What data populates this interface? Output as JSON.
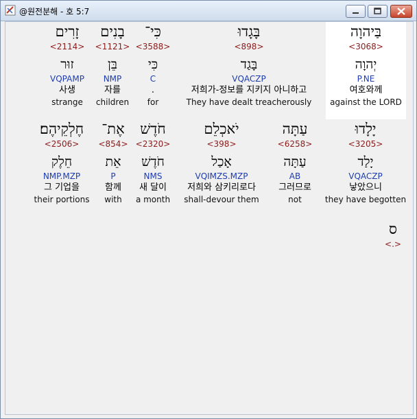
{
  "window": {
    "title": "@원전분해 - 호 5:7"
  },
  "rows": [
    [
      {
        "heb": "בַּיהוָה",
        "strong": "<3068>",
        "lex": "יְהוָה",
        "parse": "P.NE",
        "kor": "여호와께",
        "eng": "against the LORD"
      },
      {
        "heb": "בָּגָדוּ",
        "strong": "<898>",
        "lex": "בָּגַד",
        "parse": "VQACZP",
        "kor": "저희가-정보를 지키지 아니하고",
        "eng": "They have dealt treacherously"
      },
      {
        "heb": "כִּי־",
        "strong": "<3588>",
        "lex": "כִּי",
        "parse": "C",
        "kor": ".",
        "eng": "for"
      },
      {
        "heb": "בָנִים",
        "strong": "<1121>",
        "lex": "בֵּן",
        "parse": "NMP",
        "kor": "자를",
        "eng": "children"
      },
      {
        "heb": "זָרִים",
        "strong": "<2114>",
        "lex": "זוּר",
        "parse": "VQPAMP",
        "kor": "사생",
        "eng": "strange"
      }
    ],
    [
      {
        "heb": "יָלָדוּ",
        "strong": "<3205>",
        "lex": "יָלַד",
        "parse": "VQACZP",
        "kor": "낳았으니",
        "eng": "they have begotten"
      },
      {
        "heb": "עַתָּה",
        "strong": "<6258>",
        "lex": "עַתָּה",
        "parse": "AB",
        "kor": "그러므로",
        "eng": "not"
      },
      {
        "heb": "יֹאכְלֵם",
        "strong": "<398>",
        "lex": "אָכַל",
        "parse": "VQIMZS.MZP",
        "kor": "저희와 삼키리로다",
        "eng": "shall-devour them"
      },
      {
        "heb": "חֹדֶשׁ",
        "strong": "<2320>",
        "lex": "חֹדֶשׁ",
        "parse": "NMS",
        "kor": "새 달이",
        "eng": "a month"
      },
      {
        "heb": "אֶת־",
        "strong": "<854>",
        "lex": "אֵת",
        "parse": "P",
        "kor": "함께",
        "eng": "with"
      },
      {
        "heb": "חֶלְקֵיהֶם׃",
        "strong": "<2506>",
        "lex": "חֵלֶק",
        "parse": "NMP.MZP",
        "kor": "그 기업을",
        "eng": "their portions"
      }
    ],
    [
      {
        "heb": "ס",
        "strong": "<.>"
      }
    ]
  ],
  "colors": {
    "strong": "#8b1a1a",
    "parse": "#1d3cb0",
    "highlight": "#ffffff"
  },
  "icons": [
    "app-icon",
    "minimize-icon",
    "maximize-icon",
    "close-icon"
  ]
}
